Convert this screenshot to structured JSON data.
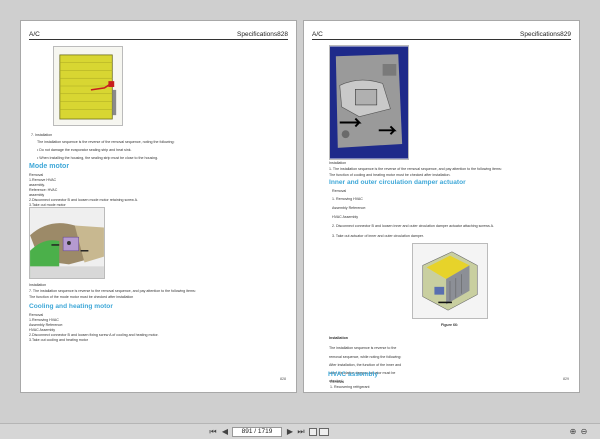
{
  "left_page": {
    "header_left": "A/C",
    "header_right": "Specifications828",
    "page_number": "828",
    "lines": [
      "7.    Installation",
      "The installation sequence is the reverse of the removal sequence, noting the following:",
      "• Do not damage the evaporator sealing strip and heat sink.",
      "• When installing the housing, the sealing strip must be close to the housing."
    ],
    "section1_title": "Mode motor",
    "section1_lines": [
      "Removal",
      "1.Remove HVAC",
      "assembly.",
      "Reference: HVAC",
      "assembly",
      "2.Disconnect connector B and loosen mode motor retaining screw A.",
      "3.Take out mode motor"
    ],
    "section1_after": [
      "Installation",
      "7. The installation sequence is reverse to the removal sequence, and pay attention to the following items:",
      "The function of the mode motor must be checked after installation"
    ],
    "section2_title": "Cooling and heating motor",
    "section2_lines": [
      "Removal",
      "1.Removing HVAC",
      "Assembly Reference:",
      "HVAC Assembly",
      "2.Disconnect connector B and loosen fixing screw A of cooling and heating motor.",
      "3.Take out cooling and heating motor"
    ]
  },
  "right_page": {
    "header_left": "A/C",
    "header_right": "Specifications829",
    "page_number": "829",
    "lines": [
      "Installation",
      "1. The installation sequence is the reverse of the removal sequence, and pay attention to the following items:",
      "The function of cooling and heating motor must be checked after installation."
    ],
    "section1_title": "Inner and outer circulation damper actuator",
    "section1_lines": [
      "Removal",
      "1. Removing HVAC",
      "Assembly Reference:",
      "HVAC Assembly",
      "2. Disconnect connector B and loosen inner and outer circulation damper actuator attaching screws A.",
      "3. Take out actuator of inner and outer circulation damper."
    ],
    "figure_caption": "Figure 66:",
    "section1_after": [
      "Installation",
      "The installation sequence is reverse to the",
      "removal sequence, while noting the following:",
      "After installation, the function of the inner and",
      "outer circulation damper actuator must be",
      "checked."
    ],
    "section2_title": "HVAC assembly",
    "section2_lines": [
      "Removal",
      "1. Recovering refrigerant"
    ]
  },
  "toolbar": {
    "page_indicator": "891 / 1719",
    "first_icon": "first-page-icon",
    "prev_icon": "previous-page-icon",
    "next_icon": "next-page-icon",
    "last_icon": "last-page-icon"
  }
}
